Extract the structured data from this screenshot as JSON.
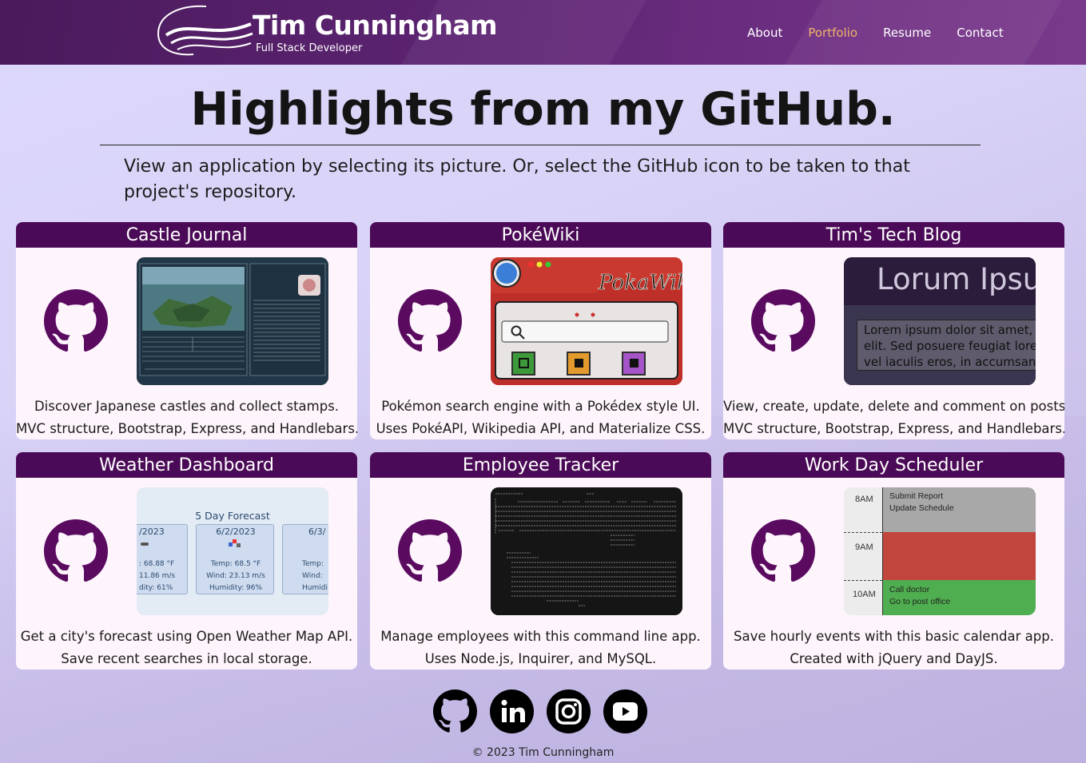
{
  "header": {
    "title": "Tim Cunningham",
    "subtitle": "Full Stack Developer",
    "nav": [
      "About",
      "Portfolio",
      "Resume",
      "Contact"
    ],
    "active_nav": "Portfolio"
  },
  "main": {
    "title": "Highlights from my GitHub.",
    "intro": "View an application by selecting its picture. Or, select the GitHub icon to be taken to that project's repository."
  },
  "projects": [
    {
      "title": "Castle Journal",
      "desc1": "Discover Japanese castles and collect stamps.",
      "desc2": "MVC structure, Bootstrap, Express, and Handlebars."
    },
    {
      "title": "PokéWiki",
      "desc1": "Pokémon search engine with a Pokédex style UI.",
      "desc2": "Uses PokéAPI, Wikipedia API, and Materialize CSS."
    },
    {
      "title": "Tim's Tech Blog",
      "desc1": "View, create, update, delete and comment on posts.",
      "desc2": "MVC structure, Bootstrap, Express, and Handlebars.",
      "preview_heading": "Lorum Ipsu",
      "preview_text": "Lorem ipsum dolor sit amet, elit. Sed posuere feugiat lore vel iaculis eros, in accumsan"
    },
    {
      "title": "Weather Dashboard",
      "desc1": "Get a city's forecast using Open Weather Map API.",
      "desc2": "Save recent searches in local storage.",
      "preview_heading": "5 Day Forecast",
      "preview_left_date": "/2023",
      "preview_left_lines": [
        ": 68.88 °F",
        "11.86 m/s",
        "dity: 61%"
      ],
      "preview_mid_date": "6/2/2023",
      "preview_mid_lines": [
        "Temp: 68.5 °F",
        "Wind: 23.13 m/s",
        "Humidity: 96%"
      ],
      "preview_right_date": "6/3/",
      "preview_right_lines": [
        "Temp:",
        "Wind:",
        "Humidi"
      ]
    },
    {
      "title": "Employee Tracker",
      "desc1": "Manage employees with this command line app.",
      "desc2": "Uses Node.js, Inquirer, and MySQL."
    },
    {
      "title": "Work Day Scheduler",
      "desc1": "Save hourly events with this basic calendar app.",
      "desc2": "Created with jQuery and DayJS.",
      "preview_hours": [
        "8AM",
        "9AM",
        "10AM"
      ],
      "preview_events_8": [
        "Submit Report",
        "Update Schedule"
      ],
      "preview_events_10": [
        "Call doctor",
        "Go to post office"
      ]
    }
  ],
  "socials": [
    "github-icon",
    "linkedin-icon",
    "instagram-icon",
    "youtube-icon"
  ],
  "footer": {
    "copyright": "© 2023 Tim Cunningham"
  },
  "colors": {
    "header": "#5b2370",
    "card_title": "#4b0a57",
    "card_bg": "#fdf4fc",
    "active_nav": "#f0b36a",
    "github_icon": "#5a0b60"
  }
}
